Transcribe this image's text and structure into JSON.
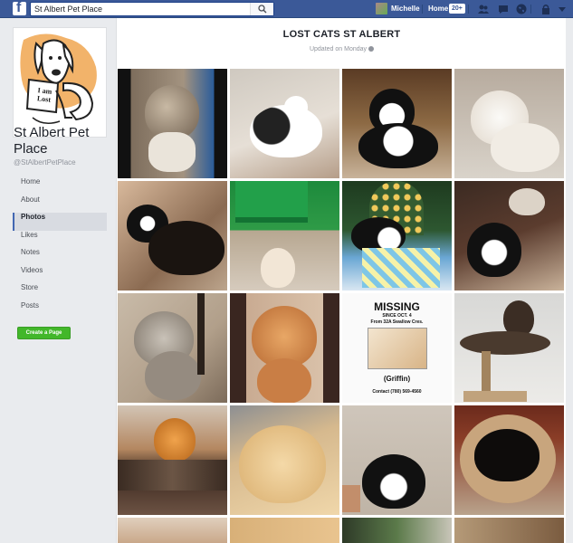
{
  "topbar": {
    "search_value": "St Albert Pet Place",
    "user_name": "Michelle",
    "home_label": "Home",
    "home_badge": "20+"
  },
  "page": {
    "name": "St Albert Pet Place",
    "handle": "@StAlbertPetPlace",
    "logo_sign_text": "I am Lost"
  },
  "nav": {
    "items": [
      "Home",
      "About",
      "Photos",
      "Likes",
      "Notes",
      "Videos",
      "Store",
      "Posts"
    ],
    "active": "Photos",
    "create_page": "Create a Page"
  },
  "album": {
    "title": "LOST CATS ST ALBERT",
    "updated": "Updated on Monday"
  },
  "missing_poster": {
    "title": "MISSING",
    "since": "SINCE OCT. 4",
    "from": "From 32A Swallow Cres.",
    "name": "(Griffin)",
    "contact": "Contact (780) 569-4560"
  },
  "colors": {
    "facebook_blue": "#3b5998",
    "create_button": "#42b72a",
    "active_nav": "#4267b2"
  }
}
